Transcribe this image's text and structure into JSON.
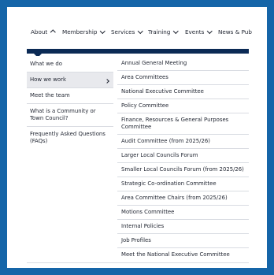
{
  "nav": {
    "items": [
      {
        "label": "About"
      },
      {
        "label": "Membership"
      },
      {
        "label": "Services"
      },
      {
        "label": "Training"
      },
      {
        "label": "Events"
      },
      {
        "label": "News & Pub"
      }
    ]
  },
  "left_menu": [
    {
      "label": "What we do"
    },
    {
      "label": "How we work"
    },
    {
      "label": "Meet the team"
    },
    {
      "label": "What is a Community or Town Council?"
    },
    {
      "label": "Frequently Asked Questions (FAQs)"
    }
  ],
  "right_menu": [
    {
      "label": "Annual General Meeting"
    },
    {
      "label": "Area Committees"
    },
    {
      "label": "National Executive Committee"
    },
    {
      "label": "Policy Committee"
    },
    {
      "label": "Finance, Resources & General Purposes Committee"
    },
    {
      "label": "Audit Committee (from 2025/26)"
    },
    {
      "label": "Larger Local Councils Forum"
    },
    {
      "label": "Smaller Local Councils Forum (from 2025/26)"
    },
    {
      "label": "Strategic Co-ordination Committee"
    },
    {
      "label": "Area Committee Chairs (from 2025/26)"
    },
    {
      "label": "Motions Committee"
    },
    {
      "label": "Internal Policies"
    },
    {
      "label": "Job Profiles"
    },
    {
      "label": "Meet the National Executive Committee"
    }
  ],
  "colors": {
    "frame": "#1565a8",
    "bar": "#0b2a55",
    "active_row": "#e8e9ed"
  }
}
